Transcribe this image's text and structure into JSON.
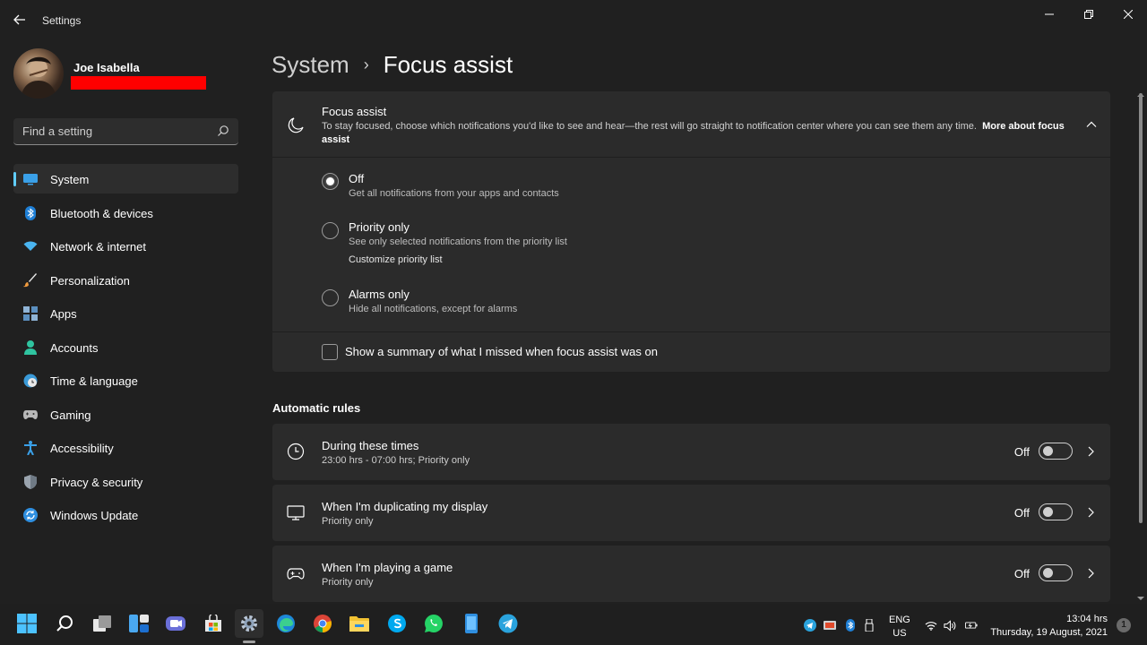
{
  "window": {
    "title": "Settings"
  },
  "profile": {
    "name": "Joe Isabella"
  },
  "search": {
    "placeholder": "Find a setting"
  },
  "sidebar": {
    "items": [
      {
        "label": "System",
        "icon": "system-icon",
        "active": true
      },
      {
        "label": "Bluetooth & devices",
        "icon": "bluetooth-icon"
      },
      {
        "label": "Network & internet",
        "icon": "wifi-icon"
      },
      {
        "label": "Personalization",
        "icon": "brush-icon"
      },
      {
        "label": "Apps",
        "icon": "apps-icon"
      },
      {
        "label": "Accounts",
        "icon": "person-icon"
      },
      {
        "label": "Time & language",
        "icon": "globe-clock-icon"
      },
      {
        "label": "Gaming",
        "icon": "gamepad-icon"
      },
      {
        "label": "Accessibility",
        "icon": "accessibility-icon"
      },
      {
        "label": "Privacy & security",
        "icon": "shield-icon"
      },
      {
        "label": "Windows Update",
        "icon": "update-icon"
      }
    ]
  },
  "breadcrumb": {
    "parent": "System",
    "separator": "›",
    "current": "Focus assist"
  },
  "focus_assist": {
    "title": "Focus assist",
    "description": "To stay focused, choose which notifications you'd like to see and hear—the rest will go straight to notification center where you can see them any time.",
    "more_link": "More about focus assist",
    "options": [
      {
        "title": "Off",
        "subtitle": "Get all notifications from your apps and contacts",
        "selected": true
      },
      {
        "title": "Priority only",
        "subtitle": "See only selected notifications from the priority list",
        "link": "Customize priority list"
      },
      {
        "title": "Alarms only",
        "subtitle": "Hide all notifications, except for alarms"
      }
    ],
    "summary_label": "Show a summary of what I missed when focus assist was on"
  },
  "automatic_rules": {
    "title": "Automatic rules",
    "rules": [
      {
        "title": "During these times",
        "subtitle": "23:00 hrs - 07:00 hrs; Priority only",
        "state": "Off",
        "icon": "clock-icon"
      },
      {
        "title": "When I'm duplicating my display",
        "subtitle": "Priority only",
        "state": "Off",
        "icon": "monitor-icon"
      },
      {
        "title": "When I'm playing a game",
        "subtitle": "Priority only",
        "state": "Off",
        "icon": "gamepad-icon"
      }
    ]
  },
  "taskbar": {
    "language": {
      "line1": "ENG",
      "line2": "US"
    },
    "clock": {
      "time": "13:04 hrs",
      "date": "Thursday, 19 August, 2021"
    },
    "notification_count": "1"
  },
  "colors": {
    "accent": "#60cdff",
    "background": "#202020",
    "card": "#2b2b2b"
  }
}
